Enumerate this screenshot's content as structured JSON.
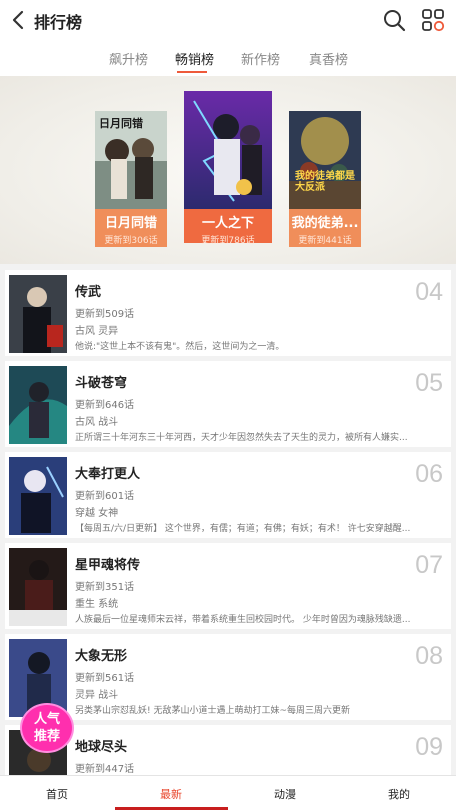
{
  "header": {
    "title": "排行榜"
  },
  "tabs": [
    {
      "label": "飙升榜"
    },
    {
      "label": "畅销榜"
    },
    {
      "label": "新作榜"
    },
    {
      "label": "真香榜"
    }
  ],
  "active_tab": "畅销榜",
  "top3": [
    {
      "title": "日月同错",
      "update": "更新到306话",
      "cover_text": "日月同错"
    },
    {
      "title": "一人之下",
      "update": "更新到786话"
    },
    {
      "title": "我的徒弟...",
      "update": "更新到441话",
      "cover_text": "我的徒弟都是大反派"
    }
  ],
  "list": [
    {
      "rank": "04",
      "title": "传武",
      "update": "更新到509话",
      "tags": "古风 灵异",
      "desc": "他说:\"这世上本不该有鬼\"。然后，这世间为之一清。"
    },
    {
      "rank": "05",
      "title": "斗破苍穹",
      "update": "更新到646话",
      "tags": "古风 战斗",
      "desc": "正所谓三十年河东三十年河西，天才少年因忽然失去了天生的灵力，被所有人嫌实..."
    },
    {
      "rank": "06",
      "title": "大奉打更人",
      "update": "更新到601话",
      "tags": "穿越 女神",
      "desc": "【每周五/六/日更新】 这个世界，有儒；有道；有佛；有妖；有术！ 许七安穿越醒..."
    },
    {
      "rank": "07",
      "title": "星甲魂将传",
      "update": "更新到351话",
      "tags": "重生 系统",
      "desc": "人族最后一位星魂师宋云祥，带着系统重生回校园时代。 少年时曾因为魂脉残缺遗..."
    },
    {
      "rank": "08",
      "title": "大象无形",
      "update": "更新到561话",
      "tags": "灵异 战斗",
      "desc": "另类茅山宗怼乱妖! 无敌茅山小道士遇上萌劫打工妹~每周三周六更新"
    },
    {
      "rank": "09",
      "title": "地球尽头",
      "update": "更新到447话",
      "tags": "",
      "desc": ""
    }
  ],
  "badge": {
    "line1": "人气",
    "line2": "推荐"
  },
  "bottom_nav": [
    {
      "label": "首页"
    },
    {
      "label": "最新"
    },
    {
      "label": "动漫"
    },
    {
      "label": "我的"
    }
  ],
  "colors": {
    "accent": "#ee5a3a",
    "podium_label": "#f08e5a",
    "podium_big_label": "#ef6a40",
    "nav_active": "#e8442a",
    "badge": "#ff2fae"
  }
}
